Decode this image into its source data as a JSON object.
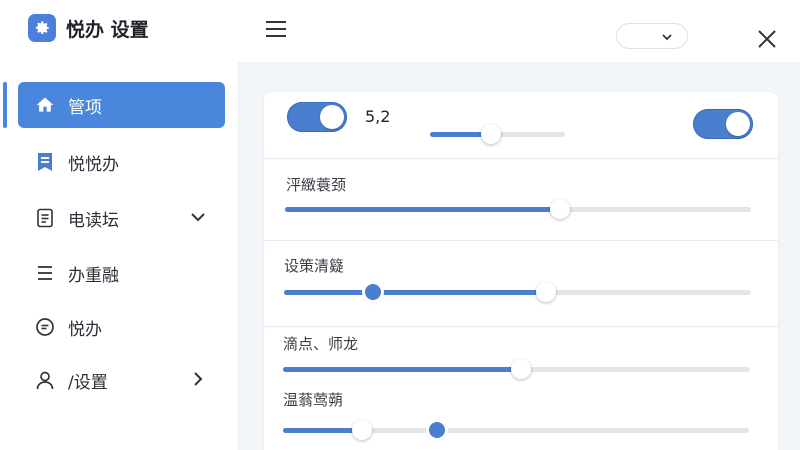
{
  "app": {
    "title": "悦办 设置",
    "logo_icon": "gear-icon",
    "accent": "#4a86dc"
  },
  "sidebar": {
    "items": [
      {
        "label": "管项",
        "icon": "home-icon",
        "active": true
      },
      {
        "label": "悦悦办",
        "icon": "bookmark-icon",
        "active": false
      },
      {
        "label": "电读坛",
        "icon": "document-icon",
        "active": false,
        "chevron": "down"
      },
      {
        "label": "办重融",
        "icon": "list-icon",
        "active": false
      },
      {
        "label": "悦办",
        "icon": "chat-icon",
        "active": false
      },
      {
        "label": "/设置",
        "icon": "user-icon",
        "active": false,
        "chevron": "right"
      }
    ]
  },
  "topbar": {
    "menu_icon": "hamburger-icon",
    "dropdown_value": "",
    "dropdown_icon": "chevron-down-icon",
    "close_icon": "close-icon"
  },
  "main": {
    "top_row": {
      "toggle_left_on": true,
      "value": "5,2",
      "mini_slider_value": 0.45,
      "toggle_right_on": true
    },
    "sliders": [
      {
        "label": "泙緻蓑颈",
        "value": 0.59
      },
      {
        "label": "设策清籎",
        "value": 0.56,
        "secondary": 0.19
      },
      {
        "label": "滴点、师龙",
        "value": 0.51
      },
      {
        "label": "温蓊莺蒴",
        "value": 0.17,
        "secondary": 0.33
      }
    ]
  }
}
